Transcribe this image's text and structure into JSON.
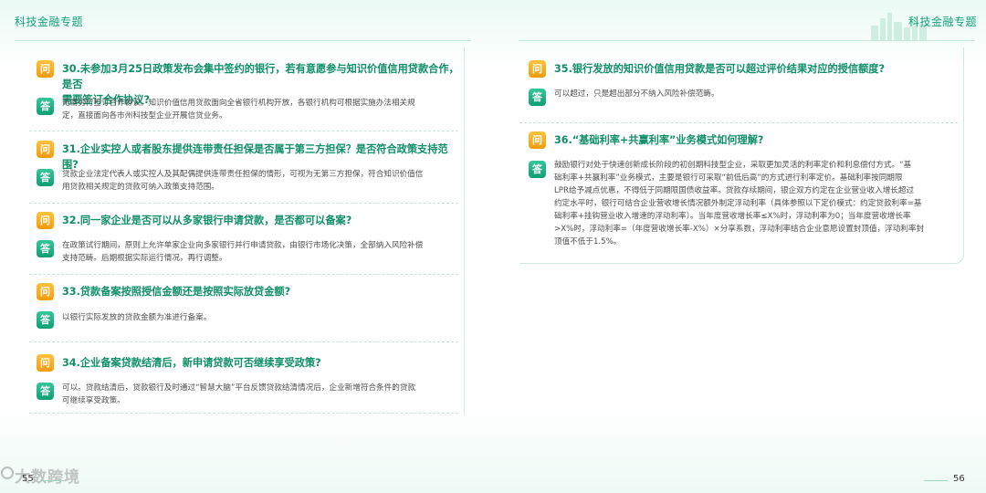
{
  "header": {
    "left_title": "科技金融专题",
    "right_title": "科技金融专题"
  },
  "badges": {
    "question": "问",
    "answer": "答"
  },
  "left_page": {
    "number": "55",
    "items": [
      {
        "question": "30.未参加3月25日政策发布会集中签约的银行，若有意愿参与知识价值信用贷款合作，是否需要签订合作协议?",
        "question_lines": [
          "30.未参加3月25日政策发布会集中签约的银行，若有意愿参与知识价值信用贷款合作，是否",
          "需要签订合作协议?"
        ],
        "answer_lines": [
          "无需另行签订合作协议。知识价值信用贷款面向全省银行机构开放，各银行机构可根据实施办法相关规",
          "定，直接面向各市州科技型企业开展信贷业务。"
        ]
      },
      {
        "question_lines": [
          "31.企业实控人或者股东提供连带责任担保是否属于第三方担保？是否符合政策支持范围?"
        ],
        "answer_lines": [
          "贷款企业法定代表人或实控人及其配偶提供连带责任担保的情形，可视为无第三方担保，符合知识价值信",
          "用贷款相关规定的贷款可纳入政策支持范围。"
        ]
      },
      {
        "question_lines": [
          "32.同一家企业是否可以从多家银行申请贷款，是否都可以备案?"
        ],
        "answer_lines": [
          "在政策试行期间，原则上允许单家企业向多家银行并行申请贷款，由银行市场化决策，全部纳入风险补偿",
          "支持范畴。后期根据实际运行情况，再行调整。"
        ]
      },
      {
        "question_lines": [
          "33.贷款备案按照授信金额还是按照实际放贷金额?"
        ],
        "answer_lines": [
          "以银行实际发放的贷款金额为准进行备案。"
        ]
      },
      {
        "question_lines": [
          "34.企业备案贷款结清后，新申请贷款可否继续享受政策?"
        ],
        "answer_lines": [
          "可以。贷款结清后，贷款银行及时通过“智慧大脑”平台反馈贷款结清情况后，企业新增符合条件的贷款",
          "可继续享受政策。"
        ]
      }
    ]
  },
  "right_page": {
    "number": "56",
    "items": [
      {
        "question_lines": [
          "35.银行发放的知识价值信用贷款是否可以超过评价结果对应的授信额度?"
        ],
        "answer_lines": [
          "可以超过，只是超出部分不纳入风险补偿范畴。"
        ]
      },
      {
        "question_lines": [
          "36.“基础利率+共赢利率”业务模式如何理解?"
        ],
        "answer_lines": [
          "鼓励银行对处于快速创新成长阶段的初创期科技型企业，采取更加灵活的利率定价和利息偿付方式。“基",
          "础利率+共赢利率”业务模式，主要是银行可采取“前低后高”的方式进行利率定价。基础利率按同期限",
          "LPR给予减点优惠，不得低于同期限国债收益率。贷款存续期间，银企双方约定在企业营业收入增长超过",
          "约定水平时，银行可结合企业营收增长情况额外制定浮动利率（具体参照以下定价模式：约定贷款利率=基",
          "础利率+挂钩营业收入增速的浮动利率）。当年度营收增长率≤X%时，浮动利率为0；当年度营收增长率",
          ">X%时，浮动利率=（年度营收增长率-X%）×分享系数，浮动利率结合企业意愿设置封顶值，浮动利率封",
          "顶值不低于1.5%。"
        ]
      }
    ]
  },
  "watermark": {
    "text": "大数跨境"
  },
  "colors": {
    "accent": "#12a37a",
    "question_badge": "#f5a623",
    "answer_badge": "#1aab80"
  }
}
